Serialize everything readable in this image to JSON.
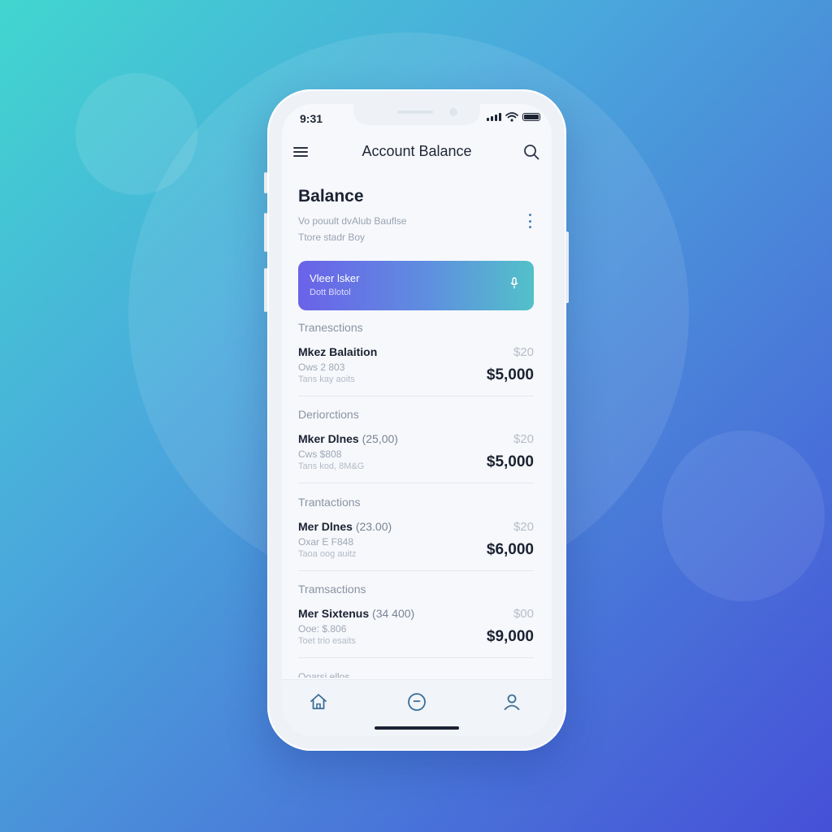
{
  "status_bar": {
    "time": "9:31"
  },
  "header": {
    "title": "Account Balance",
    "menu_icon": "hamburger-menu-icon",
    "search_icon": "search-icon"
  },
  "balance": {
    "title": "Balance",
    "subtitle_line1": "Vo pouult dvAlub Bauflse",
    "subtitle_line2": "Ttore stadr Boy",
    "more_icon": "kebab-menu-icon"
  },
  "card": {
    "title": "Vleer lsker",
    "subtitle": "Dott Blotol",
    "icon": "microphone-icon"
  },
  "sections": [
    {
      "label": "Tranesctions",
      "name": "Mkez Balaition",
      "paren": "",
      "meta1": "Ows 2 803",
      "meta2": "Tans kay aoits",
      "small_amount": "$20",
      "amount": "$5,000"
    },
    {
      "label": "Deriorctions",
      "name": "Mker Dlnes",
      "paren": "(25,00)",
      "meta1": "Cws $808",
      "meta2": "Tans kod, 8M&G",
      "small_amount": "$20",
      "amount": "$5,000"
    },
    {
      "label": "Trantactions",
      "name": "Mer Dlnes",
      "paren": "(23.00)",
      "meta1": "Oxar E F848",
      "meta2": "Taoa oog auitz",
      "small_amount": "$20",
      "amount": "$6,000"
    },
    {
      "label": "Tramsactions",
      "name": "Mer Sixtenus",
      "paren": "(34 400)",
      "meta1": "Ooe: $.806",
      "meta2": "Toet trio esaits",
      "small_amount": "$00",
      "amount": "$9,000"
    }
  ],
  "cut_label": "Ooarsi ellos",
  "tabbar": {
    "items": [
      "home-icon",
      "chat-icon",
      "profile-icon"
    ]
  },
  "colors": {
    "accent_start": "#6a62e8",
    "accent_end": "#52c1c9",
    "text_primary": "#1b2232"
  }
}
